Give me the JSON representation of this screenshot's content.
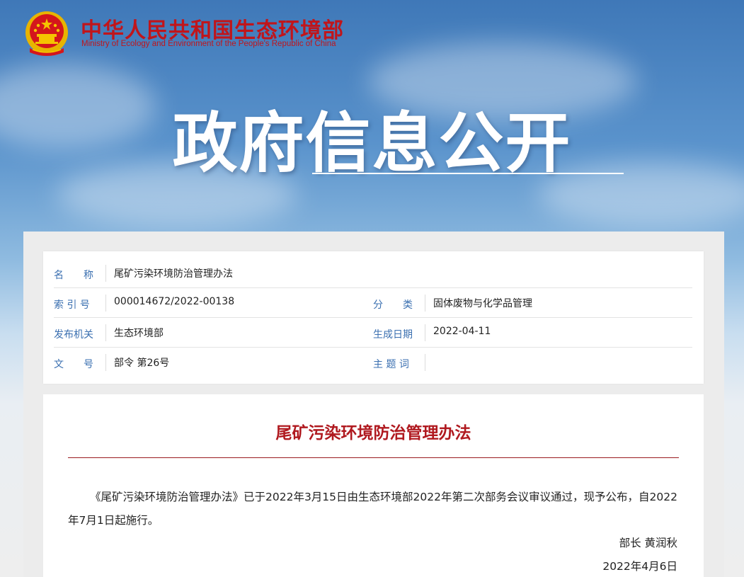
{
  "header": {
    "ministry_cn": "中华人民共和国生态环境部",
    "ministry_en": "Ministry of Ecology and Environment of the People's Republic of China",
    "banner_title": "政府信息公开",
    "emblem_icon": "national-emblem-icon"
  },
  "meta": {
    "name_label": "名　　称",
    "name_value": "尾矿污染环境防治管理办法",
    "index_label": "索 引 号",
    "index_value": "000014672/2022-00138",
    "category_label": "分　　类",
    "category_value": "固体废物与化学品管理",
    "issuer_label": "发布机关",
    "issuer_value": "生态环境部",
    "date_label": "生成日期",
    "date_value": "2022-04-11",
    "docno_label": "文　　号",
    "docno_value": "部令 第26号",
    "keywords_label": "主 题 词",
    "keywords_value": ""
  },
  "article": {
    "title": "尾矿污染环境防治管理办法",
    "paragraph": "《尾矿污染环境防治管理办法》已于2022年3月15日由生态环境部2022年第二次部务会议审议通过，现予公布，自2022年7月1日起施行。",
    "signature": "部长 黄润秋",
    "sign_date": "2022年4月6日"
  },
  "colors": {
    "brand_red": "#c0151b",
    "label_blue": "#3a6fb0"
  }
}
